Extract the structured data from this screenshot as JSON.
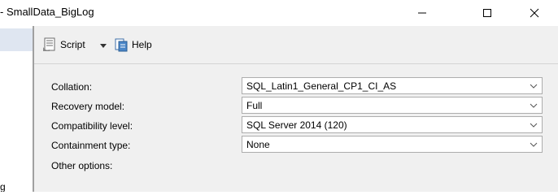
{
  "window": {
    "title": "- SmallData_BigLog"
  },
  "left_pane": {
    "cut_text": "g"
  },
  "toolbar": {
    "script_label": "Script",
    "help_label": "Help"
  },
  "properties": [
    {
      "label": "Collation:",
      "value": "SQL_Latin1_General_CP1_CI_AS"
    },
    {
      "label": "Recovery model:",
      "value": "Full"
    },
    {
      "label": "Compatibility level:",
      "value": "SQL Server 2014 (120)"
    },
    {
      "label": "Containment type:",
      "value": "None"
    }
  ],
  "other_options_label": "Other options:",
  "colors": {
    "selection": "#dfe6f1",
    "panel": "#f0f0f0",
    "combo_border": "#adadad"
  }
}
